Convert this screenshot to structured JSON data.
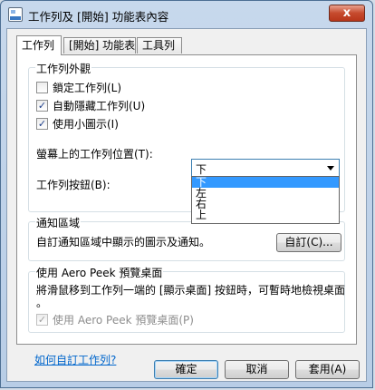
{
  "window": {
    "title": "工作列及 [開始] 功能表內容",
    "close_glyph": "x"
  },
  "tabs": [
    {
      "label": "工作列",
      "active": true
    },
    {
      "label": "[開始] 功能表",
      "active": false
    },
    {
      "label": "工具列",
      "active": false
    }
  ],
  "appearance": {
    "title": "工作列外觀",
    "lock_taskbar": {
      "label": "鎖定工作列(L)",
      "checked": false
    },
    "auto_hide": {
      "label": "自動隱藏工作列(U)",
      "checked": true
    },
    "small_icons": {
      "label": "使用小圖示(I)",
      "checked": true
    },
    "location_label": "螢幕上的工作列位置(T):",
    "location_value": "下",
    "location_options": [
      "下",
      "左",
      "右",
      "上"
    ],
    "buttons_label": "工作列按鈕(B):"
  },
  "notification": {
    "title": "通知區域",
    "description": "自訂通知區域中顯示的圖示及通知。",
    "customize_button": "自訂(C)..."
  },
  "aero_peek": {
    "title": "使用 Aero Peek 預覽桌面",
    "description_line1": "將滑鼠移到工作列一端的 [顯示桌面] 按鈕時，可暫時地檢視桌面",
    "description_line2": "。",
    "checkbox_label": "使用 Aero Peek 預覽桌面(P)",
    "checked": true,
    "disabled": true
  },
  "link_text": "如何自訂工作列?",
  "footer": {
    "ok": "確定",
    "cancel": "取消",
    "apply": "套用(A)"
  },
  "colors": {
    "accent": "#3399ff",
    "link": "#0066cc",
    "close": "#c64a2d"
  }
}
